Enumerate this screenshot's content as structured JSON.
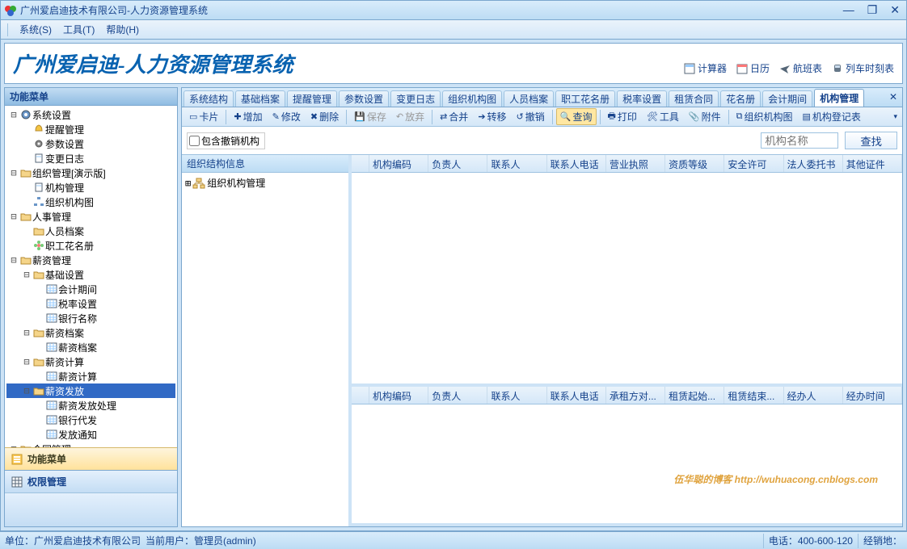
{
  "window": {
    "title": "广州爱启迪技术有限公司-人力资源管理系统"
  },
  "menubar": {
    "system": "系统(S)",
    "tools": "工具(T)",
    "help": "帮助(H)"
  },
  "header": {
    "brand": "广州爱启迪-人力资源管理系统",
    "links": {
      "calculator": "计算器",
      "calendar": "日历",
      "flights": "航班表",
      "trains": "列车时刻表"
    }
  },
  "sidebar": {
    "title": "功能菜单",
    "items": [
      {
        "d": 0,
        "t": "⊟",
        "icon": "cog",
        "label": "系统设置"
      },
      {
        "d": 1,
        "t": "",
        "icon": "bell",
        "label": "提醒管理"
      },
      {
        "d": 1,
        "t": "",
        "icon": "gear",
        "label": "参数设置"
      },
      {
        "d": 1,
        "t": "",
        "icon": "doc",
        "label": "变更日志"
      },
      {
        "d": 0,
        "t": "⊟",
        "icon": "folder-open",
        "label": "组织管理[演示版]"
      },
      {
        "d": 1,
        "t": "",
        "icon": "doc",
        "label": "机构管理"
      },
      {
        "d": 1,
        "t": "",
        "icon": "org",
        "label": "组织机构图"
      },
      {
        "d": 0,
        "t": "⊟",
        "icon": "folder-open",
        "label": "人事管理"
      },
      {
        "d": 1,
        "t": "",
        "icon": "folder",
        "label": "人员档案"
      },
      {
        "d": 1,
        "t": "",
        "icon": "flower",
        "label": "职工花名册"
      },
      {
        "d": 0,
        "t": "⊟",
        "icon": "folder-open",
        "label": "薪资管理"
      },
      {
        "d": 1,
        "t": "⊟",
        "icon": "folder-open",
        "label": "基础设置"
      },
      {
        "d": 2,
        "t": "",
        "icon": "grid",
        "label": "会计期间"
      },
      {
        "d": 2,
        "t": "",
        "icon": "grid",
        "label": "税率设置"
      },
      {
        "d": 2,
        "t": "",
        "icon": "grid",
        "label": "银行名称"
      },
      {
        "d": 1,
        "t": "⊟",
        "icon": "folder-open",
        "label": "薪资档案"
      },
      {
        "d": 2,
        "t": "",
        "icon": "grid",
        "label": "薪资档案"
      },
      {
        "d": 1,
        "t": "⊟",
        "icon": "folder-open",
        "label": "薪资计算"
      },
      {
        "d": 2,
        "t": "",
        "icon": "grid",
        "label": "薪资计算"
      },
      {
        "d": 1,
        "t": "⊟",
        "icon": "folder-open",
        "label": "薪资发放",
        "selected": true
      },
      {
        "d": 2,
        "t": "",
        "icon": "grid",
        "label": "薪资发放处理"
      },
      {
        "d": 2,
        "t": "",
        "icon": "grid",
        "label": "银行代发"
      },
      {
        "d": 2,
        "t": "",
        "icon": "grid",
        "label": "发放通知"
      },
      {
        "d": 0,
        "t": "⊞",
        "icon": "folder",
        "label": "合同管理"
      }
    ],
    "bottom": {
      "menu": "功能菜单",
      "perm": "权限管理"
    }
  },
  "tabs": [
    "系统结构",
    "基础档案",
    "提醒管理",
    "参数设置",
    "变更日志",
    "组织机构图",
    "人员档案",
    "职工花名册",
    "税率设置",
    "租赁合同",
    "花名册",
    "会计期间",
    "机构管理"
  ],
  "active_tab": 12,
  "toolbar": [
    {
      "icon": "card",
      "label": "卡片"
    },
    {
      "icon": "add",
      "label": "增加"
    },
    {
      "icon": "edit",
      "label": "修改"
    },
    {
      "icon": "del",
      "label": "删除"
    },
    {
      "icon": "save",
      "label": "保存",
      "disabled": true
    },
    {
      "icon": "undo",
      "label": "放弃",
      "disabled": true
    },
    {
      "icon": "merge",
      "label": "合并"
    },
    {
      "icon": "move",
      "label": "转移"
    },
    {
      "icon": "revoke",
      "label": "撤销"
    },
    {
      "icon": "search",
      "label": "查询",
      "active": true
    },
    {
      "icon": "print",
      "label": "打印"
    },
    {
      "icon": "tool",
      "label": "工具"
    },
    {
      "icon": "attach",
      "label": "附件"
    },
    {
      "icon": "orgchart",
      "label": "组织机构图"
    },
    {
      "icon": "reg",
      "label": "机构登记表"
    }
  ],
  "filter": {
    "include_revoked": "包含撤销机构",
    "placeholder": "机构名称",
    "search": "查找",
    "value": ""
  },
  "orgtree": {
    "header": "组织结构信息",
    "root": "组织机构管理"
  },
  "grid1": {
    "columns": [
      "机构编码",
      "负责人",
      "联系人",
      "联系人电话",
      "营业执照",
      "资质等级",
      "安全许可",
      "法人委托书",
      "其他证件"
    ]
  },
  "grid2": {
    "columns": [
      "机构编码",
      "负责人",
      "联系人",
      "联系人电话",
      "承租方对...",
      "租赁起始...",
      "租赁结束...",
      "经办人",
      "经办时间"
    ]
  },
  "watermark": "伍华聪的博客 http://wuhuacong.cnblogs.com",
  "statusbar": {
    "company": "单位：广州爱启迪技术有限公司",
    "user": "当前用户：管理员(admin)",
    "phone": "电话：400-600-120",
    "channel": "经销地："
  }
}
